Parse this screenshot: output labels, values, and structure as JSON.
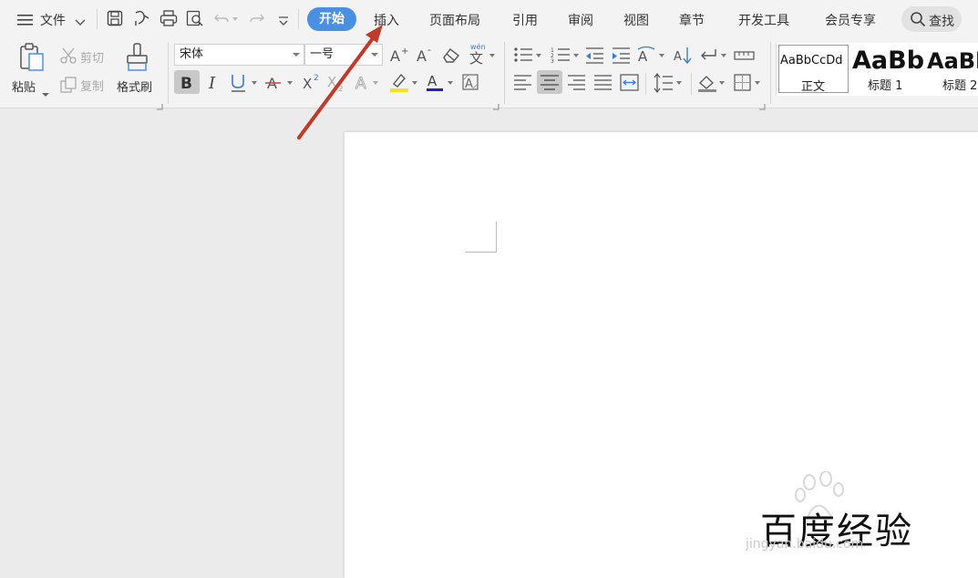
{
  "menu": {
    "file_label": "文件",
    "tabs": [
      "开始",
      "插入",
      "页面布局",
      "引用",
      "审阅",
      "视图",
      "章节",
      "开发工具",
      "会员专享"
    ],
    "search_label": "查找"
  },
  "ribbon": {
    "paste": "粘贴",
    "cut": "剪切",
    "copy": "复制",
    "format_painter": "格式刷",
    "font_name": "宋体",
    "font_size": "一号",
    "phonetic_label": "wén"
  },
  "styles": [
    {
      "preview": "AaBbCcDd",
      "name": "正文"
    },
    {
      "preview": "AaBb",
      "name": "标题 1"
    },
    {
      "preview": "AaBb",
      "name": "标题 2"
    }
  ],
  "watermark": {
    "title": "百度经验",
    "url": "jingyan.baidu.com"
  },
  "colors": {
    "accent": "#4a90e2",
    "annotation_arrow": "#c0392b",
    "font_color_bar": "#1f1fd0",
    "highlight_bar": "#f5e21a"
  }
}
